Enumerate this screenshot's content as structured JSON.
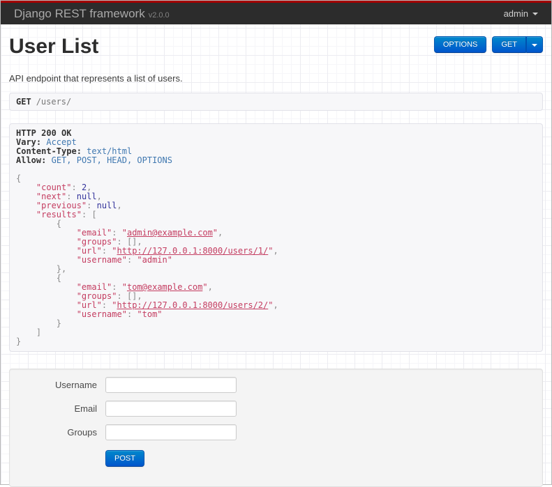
{
  "navbar": {
    "brand": "Django REST framework",
    "version": "v2.0.0",
    "user_menu_label": "admin"
  },
  "page": {
    "title": "User List",
    "description": "API endpoint that represents a list of users."
  },
  "toolbar": {
    "options_label": "OPTIONS",
    "get_label": "GET"
  },
  "request": {
    "method": "GET",
    "path": "/users/"
  },
  "response": {
    "status_line": "HTTP 200 OK",
    "headers": [
      {
        "name": "Vary",
        "value": "Accept"
      },
      {
        "name": "Content-Type",
        "value": "text/html"
      },
      {
        "name": "Allow",
        "value": "GET, POST, HEAD, OPTIONS"
      }
    ],
    "payload": {
      "count": 2,
      "next": null,
      "previous": null,
      "results": [
        {
          "email": "admin@example.com",
          "groups": [],
          "url": "http://127.0.0.1:8000/users/1/",
          "username": "admin"
        },
        {
          "email": "tom@example.com",
          "groups": [],
          "url": "http://127.0.0.1:8000/users/2/",
          "username": "tom"
        }
      ]
    },
    "lines": [
      [
        {
          "s": "b",
          "t": "HTTP 200 OK"
        }
      ],
      [
        {
          "s": "b",
          "t": "Vary:"
        },
        {
          "s": "p",
          "t": " "
        },
        {
          "s": "hv",
          "t": "Accept"
        }
      ],
      [
        {
          "s": "b",
          "t": "Content-Type:"
        },
        {
          "s": "p",
          "t": " "
        },
        {
          "s": "hv",
          "t": "text/html"
        }
      ],
      [
        {
          "s": "b",
          "t": "Allow:"
        },
        {
          "s": "p",
          "t": " "
        },
        {
          "s": "hv",
          "t": "GET, POST, HEAD, OPTIONS"
        }
      ],
      [],
      [
        {
          "s": "p",
          "t": "{"
        }
      ],
      [
        {
          "s": "p",
          "t": "    "
        },
        {
          "s": "k",
          "t": "\"count\""
        },
        {
          "s": "p",
          "t": ": "
        },
        {
          "s": "n",
          "t": "2"
        },
        {
          "s": "p",
          "t": ","
        }
      ],
      [
        {
          "s": "p",
          "t": "    "
        },
        {
          "s": "k",
          "t": "\"next\""
        },
        {
          "s": "p",
          "t": ": "
        },
        {
          "s": "n",
          "t": "null"
        },
        {
          "s": "p",
          "t": ","
        }
      ],
      [
        {
          "s": "p",
          "t": "    "
        },
        {
          "s": "k",
          "t": "\"previous\""
        },
        {
          "s": "p",
          "t": ": "
        },
        {
          "s": "n",
          "t": "null"
        },
        {
          "s": "p",
          "t": ","
        }
      ],
      [
        {
          "s": "p",
          "t": "    "
        },
        {
          "s": "k",
          "t": "\"results\""
        },
        {
          "s": "p",
          "t": ": ["
        }
      ],
      [
        {
          "s": "p",
          "t": "        {"
        }
      ],
      [
        {
          "s": "p",
          "t": "            "
        },
        {
          "s": "k",
          "t": "\"email\""
        },
        {
          "s": "p",
          "t": ": "
        },
        {
          "s": "s",
          "t": "\""
        },
        {
          "s": "a",
          "t": "admin@example.com"
        },
        {
          "s": "s",
          "t": "\""
        },
        {
          "s": "p",
          "t": ","
        }
      ],
      [
        {
          "s": "p",
          "t": "            "
        },
        {
          "s": "k",
          "t": "\"groups\""
        },
        {
          "s": "p",
          "t": ": "
        },
        {
          "s": "p",
          "t": "[],"
        }
      ],
      [
        {
          "s": "p",
          "t": "            "
        },
        {
          "s": "k",
          "t": "\"url\""
        },
        {
          "s": "p",
          "t": ": "
        },
        {
          "s": "s",
          "t": "\""
        },
        {
          "s": "a",
          "t": "http://127.0.0.1:8000/users/1/"
        },
        {
          "s": "s",
          "t": "\""
        },
        {
          "s": "p",
          "t": ","
        }
      ],
      [
        {
          "s": "p",
          "t": "            "
        },
        {
          "s": "k",
          "t": "\"username\""
        },
        {
          "s": "p",
          "t": ": "
        },
        {
          "s": "s",
          "t": "\"admin\""
        }
      ],
      [
        {
          "s": "p",
          "t": "        },"
        }
      ],
      [
        {
          "s": "p",
          "t": "        {"
        }
      ],
      [
        {
          "s": "p",
          "t": "            "
        },
        {
          "s": "k",
          "t": "\"email\""
        },
        {
          "s": "p",
          "t": ": "
        },
        {
          "s": "s",
          "t": "\""
        },
        {
          "s": "a",
          "t": "tom@example.com"
        },
        {
          "s": "s",
          "t": "\""
        },
        {
          "s": "p",
          "t": ","
        }
      ],
      [
        {
          "s": "p",
          "t": "            "
        },
        {
          "s": "k",
          "t": "\"groups\""
        },
        {
          "s": "p",
          "t": ": "
        },
        {
          "s": "p",
          "t": "[],"
        }
      ],
      [
        {
          "s": "p",
          "t": "            "
        },
        {
          "s": "k",
          "t": "\"url\""
        },
        {
          "s": "p",
          "t": ": "
        },
        {
          "s": "s",
          "t": "\""
        },
        {
          "s": "a",
          "t": "http://127.0.0.1:8000/users/2/"
        },
        {
          "s": "s",
          "t": "\""
        },
        {
          "s": "p",
          "t": ","
        }
      ],
      [
        {
          "s": "p",
          "t": "            "
        },
        {
          "s": "k",
          "t": "\"username\""
        },
        {
          "s": "p",
          "t": ": "
        },
        {
          "s": "s",
          "t": "\"tom\""
        }
      ],
      [
        {
          "s": "p",
          "t": "        }"
        }
      ],
      [
        {
          "s": "p",
          "t": "    ]"
        }
      ],
      [
        {
          "s": "p",
          "t": "}"
        }
      ]
    ]
  },
  "form": {
    "fields": [
      {
        "label": "Username",
        "value": ""
      },
      {
        "label": "Email",
        "value": ""
      },
      {
        "label": "Groups",
        "value": ""
      }
    ],
    "submit_label": "POST"
  },
  "colors": {
    "topbar_stripe": "#a30000",
    "navbar_bg": "#2c2c2c",
    "button_blue_top": "#0088cc",
    "button_blue_bottom": "#0055cc",
    "json_key": "#c43c60",
    "json_null_number": "#33339b",
    "header_value_blue": "#4078b0",
    "panel_bg": "#f7f7f9"
  }
}
